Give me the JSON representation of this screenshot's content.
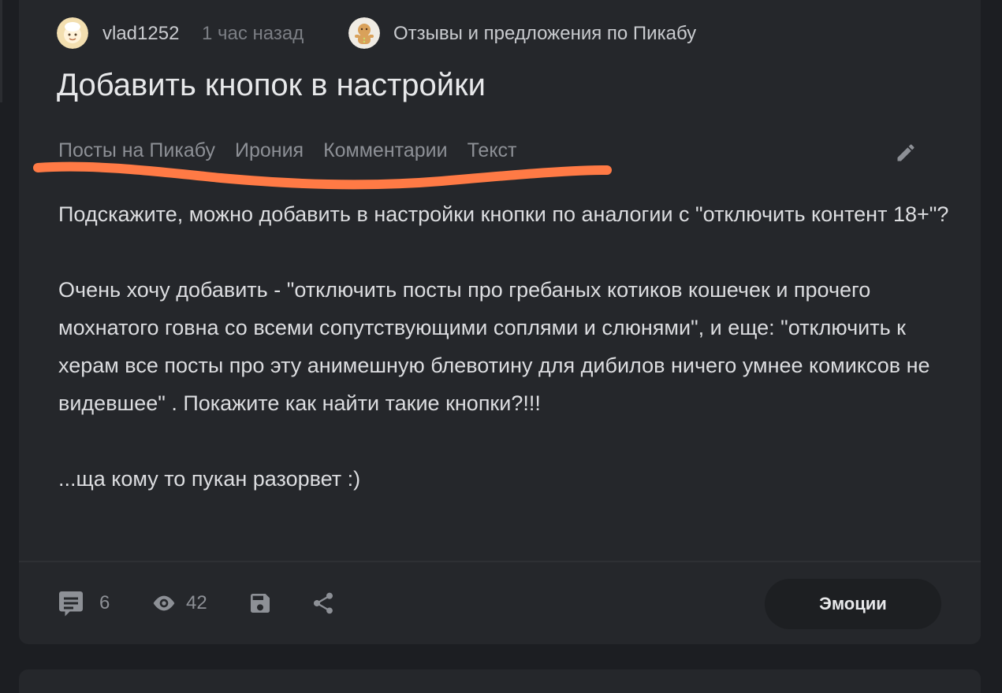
{
  "post": {
    "author": "vlad1252",
    "time": "1 час назад",
    "community": "Отзывы и предложения по Пикабу",
    "title": "Добавить кнопок в настройки",
    "tags": [
      "Посты на Пикабу",
      "Ирония",
      "Комментарии",
      "Текст"
    ],
    "body": [
      "Подскажите, можно добавить в настройки кнопки по аналогии с \"отключить контент 18+\"?",
      "Очень хочу добавить - \"отключить посты про гребаных котиков кошечек и прочего мохнатого говна со всеми сопутствующими соплями и слюнями\", и еще: \"отключить к херам все посты про эту анимешную блевотину для дибилов ничего умнее комиксов не видевшее\" . Покажите как найти такие кнопки?!!!",
      "...ща кому то пукан разорвет :)"
    ]
  },
  "footer": {
    "comments_count": "6",
    "views_count": "42",
    "emotions_label": "Эмоции"
  },
  "colors": {
    "background": "#1c1e22",
    "card": "#25272b",
    "highlight_underline": "#ff7a45"
  },
  "icons": [
    "user-avatar",
    "community-avatar",
    "pencil-icon",
    "comment-icon",
    "eye-icon",
    "save-icon",
    "share-icon"
  ]
}
